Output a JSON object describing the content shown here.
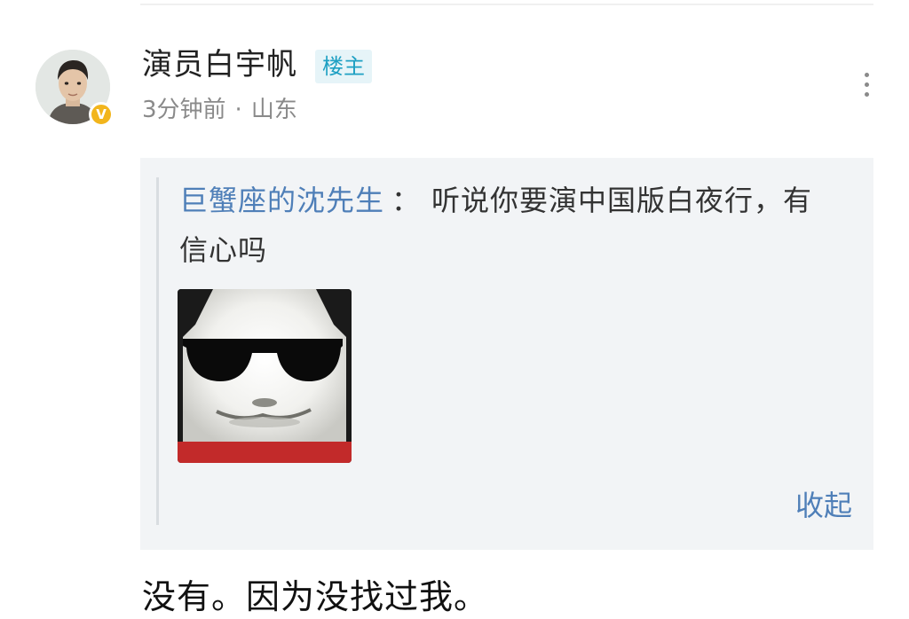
{
  "comment": {
    "username": "演员白宇帆",
    "op_badge": "楼主",
    "time": "3分钟前",
    "separator": "·",
    "location": "山东",
    "verified_mark": "V",
    "more_icon": "more-vertical-icon",
    "reply": "没有。因为没找过我。"
  },
  "quote": {
    "author": "巨蟹座的沈先生",
    "colon": "：",
    "text": "听说你要演中国版白夜行，有信心吗",
    "collapse_label": "收起",
    "image_icon": "sunglasses-meme-image"
  },
  "colors": {
    "link": "#4f7fb8",
    "op_badge_text": "#1ea0c3",
    "op_badge_bg": "#e6f4f8",
    "quote_bg": "#f2f4f6",
    "verified": "#f2b51c"
  }
}
